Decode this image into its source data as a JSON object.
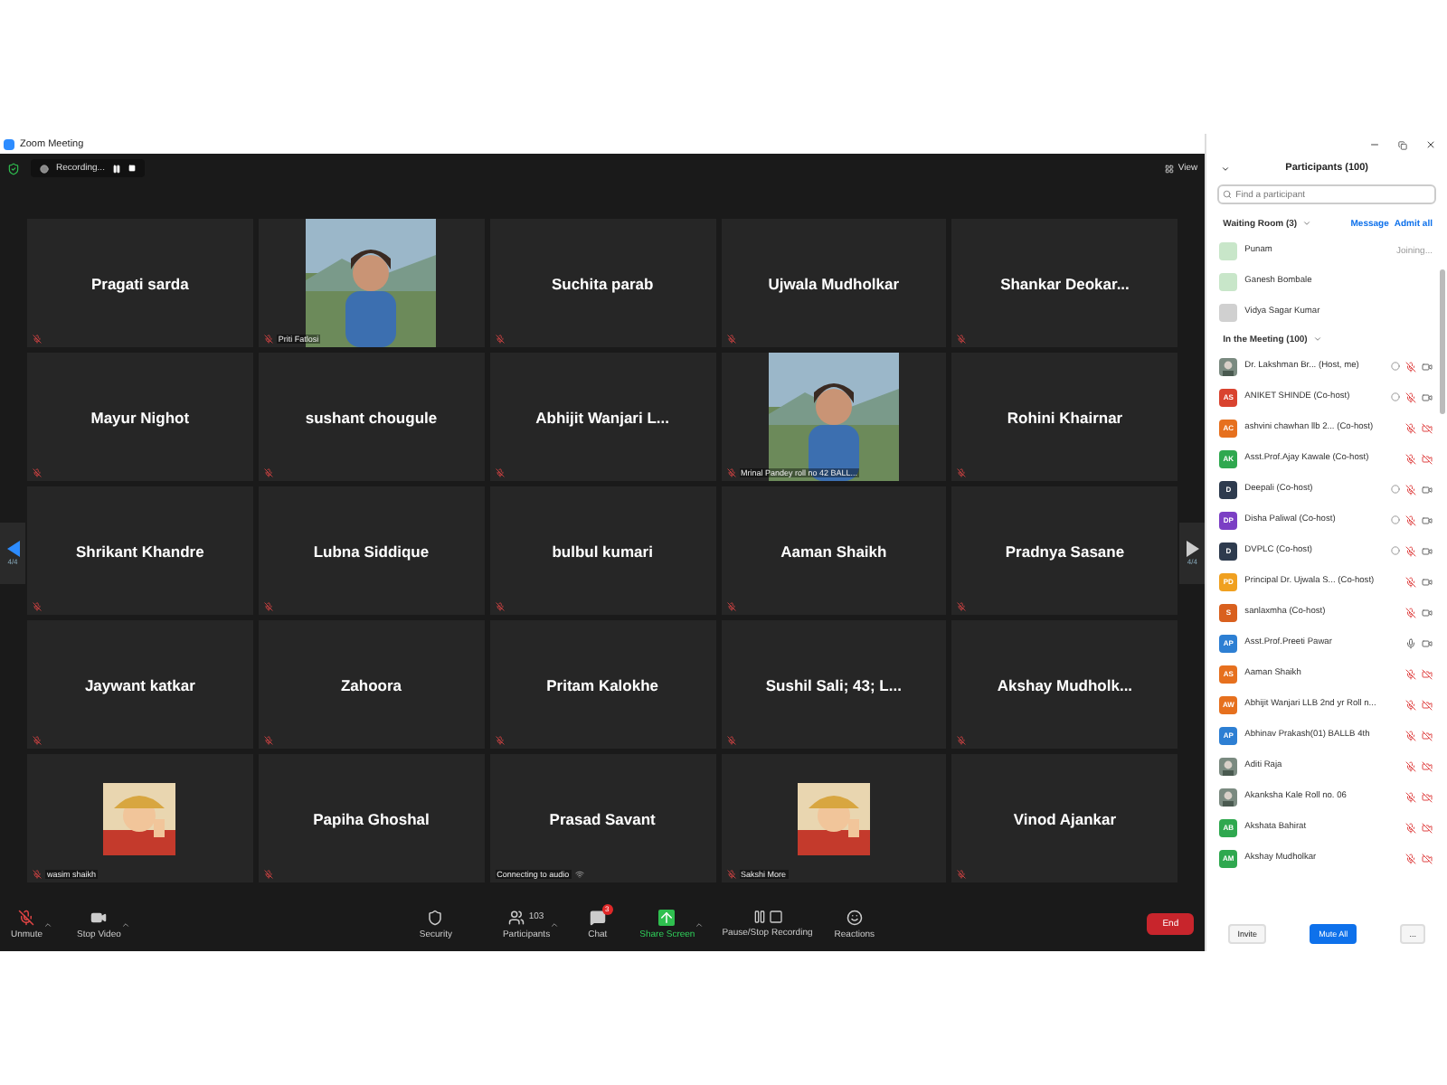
{
  "window": {
    "title": "Zoom Meeting"
  },
  "top_bar": {
    "recording": "Recording...",
    "view": "View"
  },
  "pager": {
    "left": "4/4",
    "right": "4/4"
  },
  "tiles": [
    {
      "kind": "name",
      "name": "Pragati sarda"
    },
    {
      "kind": "video",
      "label": "Priti Fatlosi"
    },
    {
      "kind": "name",
      "name": "Suchita parab"
    },
    {
      "kind": "name",
      "name": "Ujwala Mudholkar"
    },
    {
      "kind": "name",
      "name": "Shankar  Deokar..."
    },
    {
      "kind": "name",
      "name": "Mayur Nighot"
    },
    {
      "kind": "name",
      "name": "sushant chougule"
    },
    {
      "kind": "name",
      "name": "Abhijit  Wanjari  L..."
    },
    {
      "kind": "video",
      "label": "Mrinal Pandey roll no 42 BALL..."
    },
    {
      "kind": "name",
      "name": "Rohini Khairnar"
    },
    {
      "kind": "name",
      "name": "Shrikant Khandre"
    },
    {
      "kind": "name",
      "name": "Lubna Siddique"
    },
    {
      "kind": "name",
      "name": "bulbul kumari"
    },
    {
      "kind": "name",
      "name": "Aaman Shaikh"
    },
    {
      "kind": "name",
      "name": "Pradnya Sasane"
    },
    {
      "kind": "name",
      "name": "Jaywant katkar"
    },
    {
      "kind": "name",
      "name": "Zahoora"
    },
    {
      "kind": "name",
      "name": "Pritam Kalokhe"
    },
    {
      "kind": "name",
      "name": "Sushil Sali; 43; L..."
    },
    {
      "kind": "name",
      "name": "Akshay  Mudholk..."
    },
    {
      "kind": "avatar",
      "label": "wasim shaikh"
    },
    {
      "kind": "name",
      "name": "Papiha Ghoshal"
    },
    {
      "kind": "name",
      "name": "Prasad Savant",
      "status": "Connecting to audio"
    },
    {
      "kind": "avatar",
      "label": "Sakshi More"
    },
    {
      "kind": "name",
      "name": "Vinod Ajankar"
    }
  ],
  "toolbar": {
    "unmute": "Unmute",
    "stop_video": "Stop Video",
    "security": "Security",
    "participants": "Participants",
    "participant_count": "103",
    "chat": "Chat",
    "chat_badge": "3",
    "share": "Share Screen",
    "recording": "Pause/Stop Recording",
    "reactions": "Reactions",
    "end": "End"
  },
  "panel": {
    "title": "Participants (100)",
    "search": {
      "placeholder": "Find a participant"
    },
    "waiting_header": "Waiting Room (3)",
    "message": "Message",
    "admit_all": "Admit all",
    "waiting": [
      {
        "name": "Punam",
        "status": "Joining...",
        "color": "#c8e6c9"
      },
      {
        "name": "Ganesh Bombale",
        "color": "#c8e6c9"
      },
      {
        "name": "Vidya Sagar Kumar",
        "color": "#d0d0d0"
      }
    ],
    "meeting_header": "In the Meeting (100)",
    "participants": [
      {
        "name": "Dr. Lakshman Br...",
        "role": "(Host, me)",
        "kind": "picture",
        "recording": true,
        "mic_muted": true,
        "video_off": false
      },
      {
        "name": "ANIKET SHINDE",
        "role": "(Co-host)",
        "kind": "initials",
        "initials": "AS",
        "color": "#d9432f",
        "recording": true,
        "mic_muted": true,
        "video_off": false
      },
      {
        "name": "ashvini chawhan llb 2...",
        "role": "(Co-host)",
        "kind": "initials",
        "initials": "AC",
        "color": "#e6701e",
        "recording": false,
        "mic_muted": true,
        "video_off": true
      },
      {
        "name": "Asst.Prof.Ajay Kawale",
        "role": "(Co-host)",
        "kind": "initials",
        "initials": "AK",
        "color": "#2fa84f",
        "recording": false,
        "mic_muted": true,
        "video_off": true
      },
      {
        "name": "Deepali",
        "role": "(Co-host)",
        "kind": "initials",
        "initials": "D",
        "color": "#2e3b4e",
        "recording": true,
        "mic_muted": true,
        "video_off": false
      },
      {
        "name": "Disha Paliwal",
        "role": "(Co-host)",
        "kind": "initials",
        "initials": "DP",
        "color": "#7b3fc4",
        "recording": true,
        "mic_muted": true,
        "video_off": false
      },
      {
        "name": "DVPLC",
        "role": "(Co-host)",
        "kind": "initials",
        "initials": "D",
        "color": "#2e3b4e",
        "recording": true,
        "mic_muted": true,
        "video_off": false
      },
      {
        "name": "Principal Dr. Ujwala S...",
        "role": "(Co-host)",
        "kind": "initials",
        "initials": "PD",
        "color": "#f0a020",
        "recording": false,
        "mic_muted": true,
        "video_off": false
      },
      {
        "name": "sanlaxmha",
        "role": "(Co-host)",
        "kind": "initials",
        "initials": "S",
        "color": "#d9601e",
        "recording": false,
        "mic_muted": true,
        "video_off": false
      },
      {
        "name": "Asst.Prof.Preeti Pawar",
        "kind": "initials",
        "initials": "AP",
        "color": "#2d7fd3",
        "recording": false,
        "mic_muted": false,
        "video_off": false
      },
      {
        "name": "Aaman Shaikh",
        "kind": "initials",
        "initials": "AS",
        "color": "#e6701e",
        "recording": false,
        "mic_muted": true,
        "video_off": true
      },
      {
        "name": "Abhijit Wanjari LLB 2nd yr Roll n...",
        "kind": "initials",
        "initials": "AW",
        "color": "#e6701e",
        "recording": false,
        "mic_muted": true,
        "video_off": true
      },
      {
        "name": "Abhinav Prakash(01) BALLB 4th",
        "kind": "initials",
        "initials": "AP",
        "color": "#2d7fd3",
        "recording": false,
        "mic_muted": true,
        "video_off": true
      },
      {
        "name": "Aditi Raja",
        "kind": "picture",
        "recording": false,
        "mic_muted": true,
        "video_off": true
      },
      {
        "name": "Akanksha Kale Roll no. 06",
        "kind": "picture",
        "recording": false,
        "mic_muted": true,
        "video_off": true
      },
      {
        "name": "Akshata Bahirat",
        "kind": "initials",
        "initials": "AB",
        "color": "#2fa84f",
        "recording": false,
        "mic_muted": true,
        "video_off": true
      },
      {
        "name": "Akshay Mudholkar",
        "kind": "initials",
        "initials": "AM",
        "color": "#2fa84f",
        "recording": false,
        "mic_muted": true,
        "video_off": true
      }
    ],
    "buttons": {
      "invite": "Invite",
      "mute_all": "Mute All",
      "more": "..."
    }
  }
}
